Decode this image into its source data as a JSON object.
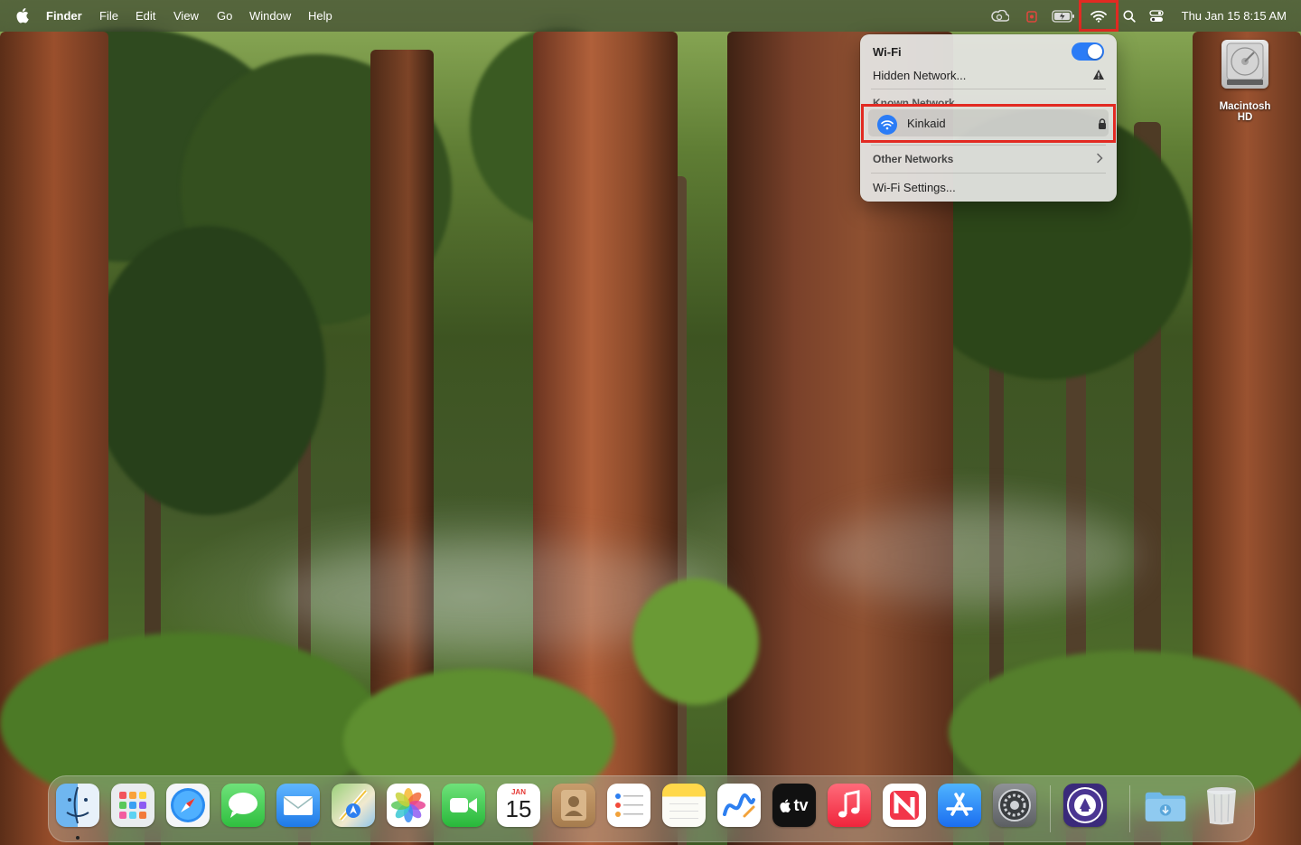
{
  "menubar": {
    "app_name": "Finder",
    "menus": [
      "File",
      "Edit",
      "View",
      "Go",
      "Window",
      "Help"
    ],
    "clock": "Thu Jan 15  8:15 AM"
  },
  "wifi_menu": {
    "title": "Wi-Fi",
    "enabled": true,
    "hidden_network": "Hidden Network...",
    "known_network_header": "Known Network",
    "known_networks": [
      {
        "name": "Kinkaid",
        "secured": true,
        "connected": true
      }
    ],
    "other_networks": "Other Networks",
    "settings": "Wi-Fi Settings..."
  },
  "desktop": {
    "drive_label": "Macintosh HD"
  },
  "dock": {
    "apps": [
      {
        "name": "Finder",
        "icon": "finder-icon"
      },
      {
        "name": "Launchpad",
        "icon": "launchpad-icon"
      },
      {
        "name": "Safari",
        "icon": "safari-icon"
      },
      {
        "name": "Messages",
        "icon": "messages-icon"
      },
      {
        "name": "Mail",
        "icon": "mail-icon"
      },
      {
        "name": "Maps",
        "icon": "maps-icon"
      },
      {
        "name": "Photos",
        "icon": "photos-icon"
      },
      {
        "name": "FaceTime",
        "icon": "facetime-icon"
      },
      {
        "name": "Calendar",
        "icon": "calendar-icon",
        "month": "JAN",
        "day": "15"
      },
      {
        "name": "Contacts",
        "icon": "contacts-icon"
      },
      {
        "name": "Reminders",
        "icon": "reminders-icon"
      },
      {
        "name": "Notes",
        "icon": "notes-icon"
      },
      {
        "name": "Freeform",
        "icon": "freeform-icon"
      },
      {
        "name": "TV",
        "icon": "tv-icon",
        "text": "tv"
      },
      {
        "name": "Music",
        "icon": "music-icon"
      },
      {
        "name": "News",
        "icon": "news-icon"
      },
      {
        "name": "App Store",
        "icon": "app-store-icon"
      },
      {
        "name": "System Settings",
        "icon": "system-settings-icon"
      },
      {
        "name": "Self Service",
        "icon": "school-seal-icon"
      },
      {
        "name": "Downloads",
        "icon": "downloads-folder-icon"
      },
      {
        "name": "Trash",
        "icon": "trash-icon"
      }
    ]
  },
  "colors": {
    "accent": "#2b7cf6",
    "highlight": "#e22a22"
  }
}
